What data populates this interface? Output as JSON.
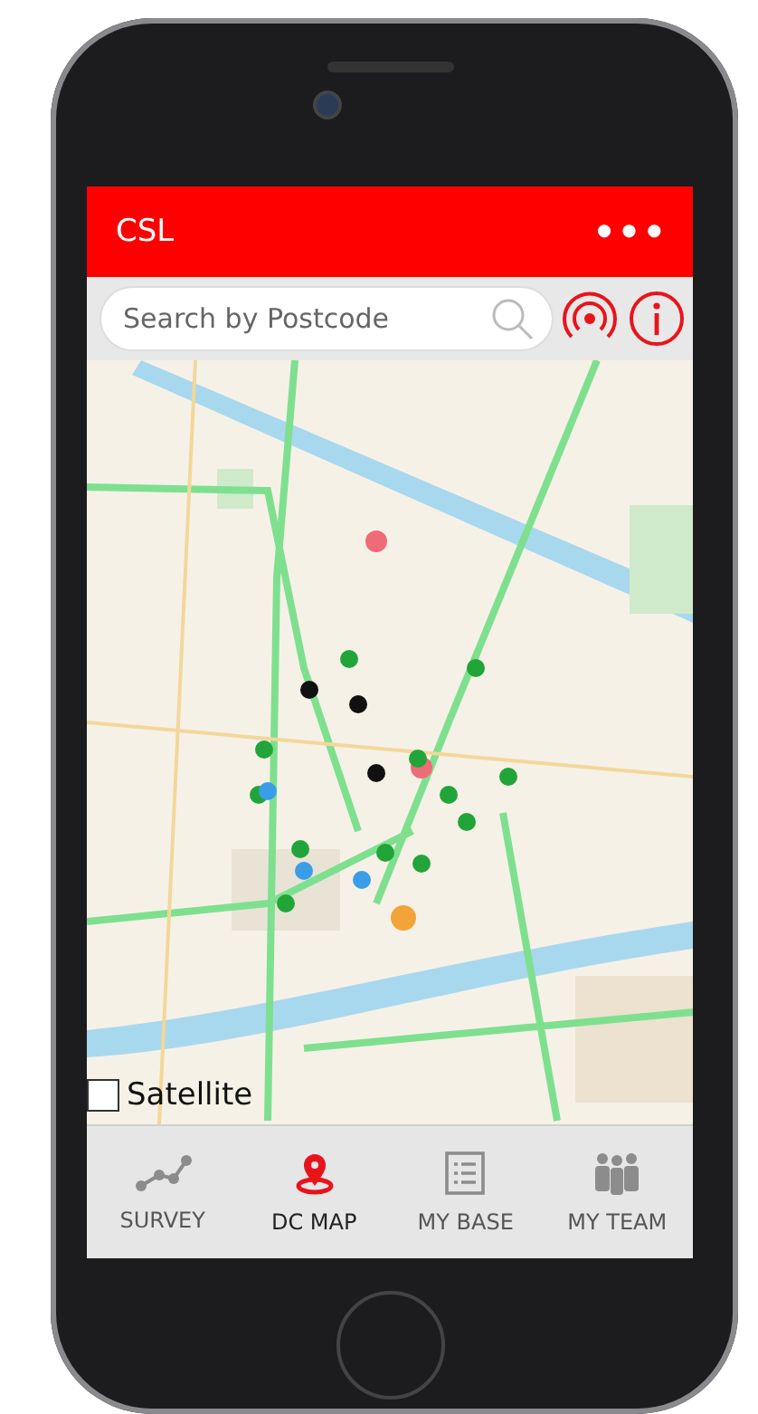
{
  "header": {
    "title": "CSL",
    "menu": "•••"
  },
  "search": {
    "placeholder": "Search by Postcode"
  },
  "map": {
    "satellite": {
      "label": "Satellite",
      "checked": false
    }
  },
  "tabs": [
    {
      "label": "SURVEY",
      "kind": "survey",
      "selected": false
    },
    {
      "label": "DC MAP",
      "kind": "map",
      "selected": true
    },
    {
      "label": "MY BASE",
      "kind": "base",
      "selected": false
    },
    {
      "label": "MY TEAM",
      "kind": "team",
      "selected": false
    }
  ]
}
